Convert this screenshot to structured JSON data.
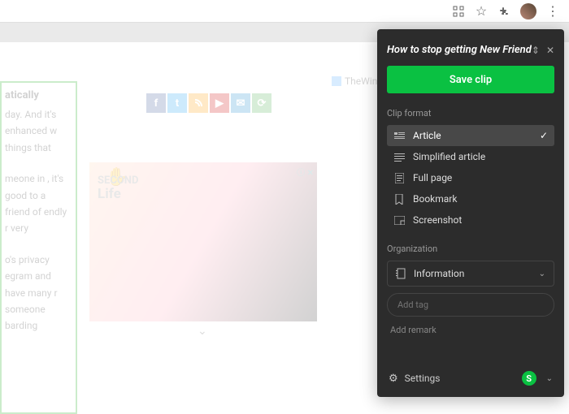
{
  "browser": {
    "icons": [
      "qr",
      "star",
      "puzzle",
      "avatar",
      "menu"
    ]
  },
  "article": {
    "heading_fragment": "atically",
    "p1": "day. And it's enhanced w things that",
    "p2": "meone in , it's good to a friend of endly r very",
    "p3": "o's privacy egram and have many r someone barding"
  },
  "logo_text": "TheWindowsClub",
  "ad": {
    "brand_top": "SECOND",
    "brand_bottom": "Life"
  },
  "clipper": {
    "title": "How to stop getting New Friend",
    "save_label": "Save clip",
    "format_label": "Clip format",
    "formats": [
      {
        "icon": "article",
        "label": "Article",
        "selected": true
      },
      {
        "icon": "simplified",
        "label": "Simplified article",
        "selected": false
      },
      {
        "icon": "fullpage",
        "label": "Full page",
        "selected": false
      },
      {
        "icon": "bookmark",
        "label": "Bookmark",
        "selected": false
      },
      {
        "icon": "screenshot",
        "label": "Screenshot",
        "selected": false
      }
    ],
    "org_label": "Organization",
    "notebook": "Information",
    "tag_placeholder": "Add tag",
    "remark": "Add remark",
    "settings": "Settings",
    "account_initial": "S"
  }
}
